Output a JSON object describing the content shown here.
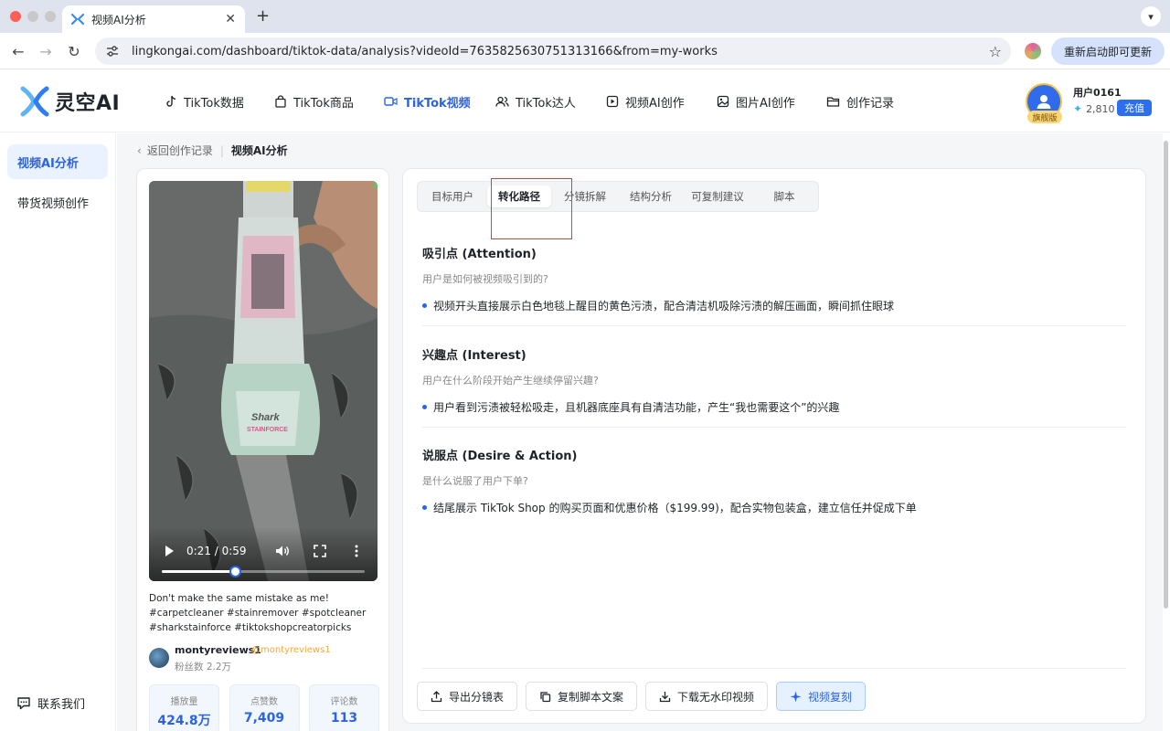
{
  "browser": {
    "tab_title": "视频AI分析",
    "url": "lingkongai.com/dashboard/tiktok-data/analysis?videoId=7635825630751313166&from=my-works",
    "update_label": "重新启动即可更新"
  },
  "header": {
    "brand": "灵空AI",
    "nav": [
      {
        "label": "TikTok数据"
      },
      {
        "label": "TikTok商品"
      },
      {
        "label": "TikTok视频"
      },
      {
        "label": "TikTok达人"
      },
      {
        "label": "视频AI创作"
      },
      {
        "label": "图片AI创作"
      },
      {
        "label": "创作记录"
      }
    ],
    "user": {
      "name": "用户0161",
      "badge": "旗舰版",
      "credits": "2,810",
      "recharge": "充值"
    }
  },
  "sidebar": {
    "items": [
      {
        "label": "视频AI分析"
      },
      {
        "label": "带货视频创作"
      }
    ],
    "contact": "联系我们"
  },
  "breadcrumb": {
    "back": "返回创作记录",
    "current": "视频AI分析"
  },
  "video": {
    "time": "0:21 / 0:59",
    "progress": 0.36,
    "product_brand": "Shark",
    "product_line": "STAINFORCE",
    "description": "Don't make the same mistake as me! #carpetcleaner #stainremover #spotcleaner #sharkstainforce #tiktokshopcreatorpicks Prices and discounts may…",
    "creator": {
      "name": "montyreviews1",
      "handle": "@montyreviews1",
      "fans": "粉丝数 2.2万"
    },
    "stats": [
      {
        "label": "播放量",
        "value": "424.8万"
      },
      {
        "label": "点赞数",
        "value": "7,409"
      },
      {
        "label": "评论数",
        "value": "113"
      }
    ]
  },
  "analysis": {
    "tabs": [
      {
        "label": "目标用户"
      },
      {
        "label": "转化路径"
      },
      {
        "label": "分镜拆解"
      },
      {
        "label": "结构分析"
      },
      {
        "label": "可复制建议"
      },
      {
        "label": "脚本"
      }
    ],
    "active_tab": "转化路径",
    "sections": [
      {
        "title": "吸引点 (Attention)",
        "question": "用户是如何被视频吸引到的?",
        "bullet": "视频开头直接展示白色地毯上醒目的黄色污渍，配合清洁机吸除污渍的解压画面，瞬间抓住眼球"
      },
      {
        "title": "兴趣点 (Interest)",
        "question": "用户在什么阶段开始产生继续停留兴趣?",
        "bullet": "用户看到污渍被轻松吸走，且机器底座具有自清洁功能，产生“我也需要这个”的兴趣"
      },
      {
        "title": "说服点 (Desire & Action)",
        "question": "是什么说服了用户下单?",
        "bullet": "结尾展示 TikTok Shop 的购买页面和优惠价格（$199.99)，配合实物包装盒，建立信任并促成下单"
      }
    ],
    "actions": [
      {
        "label": "导出分镜表"
      },
      {
        "label": "复制脚本文案"
      },
      {
        "label": "下载无水印视频"
      },
      {
        "label": "视频复刻"
      }
    ]
  },
  "colors": {
    "accent": "#2b63e6",
    "highlight": "#e53935"
  }
}
